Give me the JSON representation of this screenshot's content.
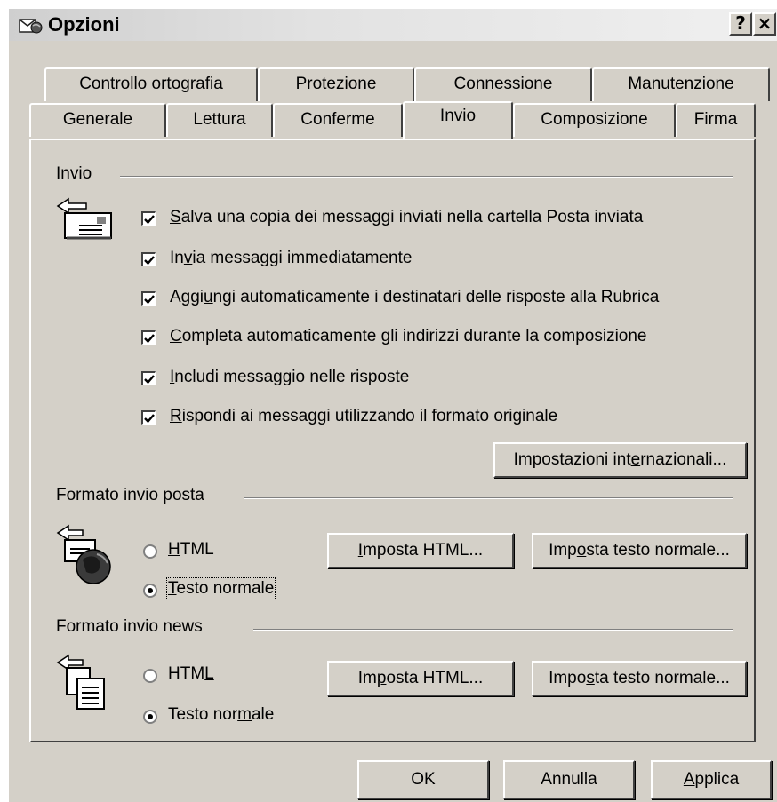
{
  "window": {
    "title": "Opzioni",
    "help_glyph": "?",
    "close_glyph": "×"
  },
  "tabs_back": [
    "Controllo ortografia",
    "Protezione",
    "Connessione",
    "Manutenzione"
  ],
  "tabs_front": [
    "Generale",
    "Lettura",
    "Conferme",
    "Invio",
    "Composizione",
    "Firma"
  ],
  "active_tab": "Invio",
  "invio": {
    "group_label": "Invio",
    "options": [
      {
        "pre": "",
        "u": "S",
        "post": "alva una copia dei messaggi inviati nella cartella Posta inviata",
        "checked": true
      },
      {
        "pre": "In",
        "u": "v",
        "post": "ia messaggi immediatamente",
        "checked": true
      },
      {
        "pre": "Aggi",
        "u": "u",
        "post": "ngi automaticamente i destinatari delle risposte alla Rubrica",
        "checked": true
      },
      {
        "pre": "",
        "u": "C",
        "post": "ompleta automaticamente gli indirizzi durante la composizione",
        "checked": true
      },
      {
        "pre": "",
        "u": "I",
        "post": "ncludi messaggio nelle risposte",
        "checked": true
      },
      {
        "pre": "",
        "u": "R",
        "post": "ispondi ai messaggi utilizzando il formato originale",
        "checked": true
      }
    ],
    "intl_button": {
      "pre": "Impostazioni int",
      "u": "e",
      "post": "rnazionali..."
    }
  },
  "posta": {
    "group_label": "Formato invio posta",
    "html": {
      "pre": "",
      "u": "H",
      "post": "TML",
      "selected": false
    },
    "testo": {
      "pre": "",
      "u": "T",
      "post": "esto normale",
      "selected": true
    },
    "btn_html": {
      "pre": "",
      "u": "I",
      "post": "mposta HTML..."
    },
    "btn_testo": {
      "pre": "Imp",
      "u": "o",
      "post": "sta testo normale..."
    }
  },
  "news": {
    "group_label": "Formato invio news",
    "html": {
      "pre": "HTM",
      "u": "L",
      "post": "",
      "selected": false
    },
    "testo": {
      "pre": "Testo nor",
      "u": "m",
      "post": "ale",
      "selected": true
    },
    "btn_html": {
      "pre": "Im",
      "u": "p",
      "post": "osta HTML..."
    },
    "btn_testo": {
      "pre": "Impo",
      "u": "s",
      "post": "ta testo normale..."
    }
  },
  "footer": {
    "ok": "OK",
    "cancel": "Annulla",
    "apply": {
      "pre": "",
      "u": "A",
      "post": "pplica"
    }
  }
}
